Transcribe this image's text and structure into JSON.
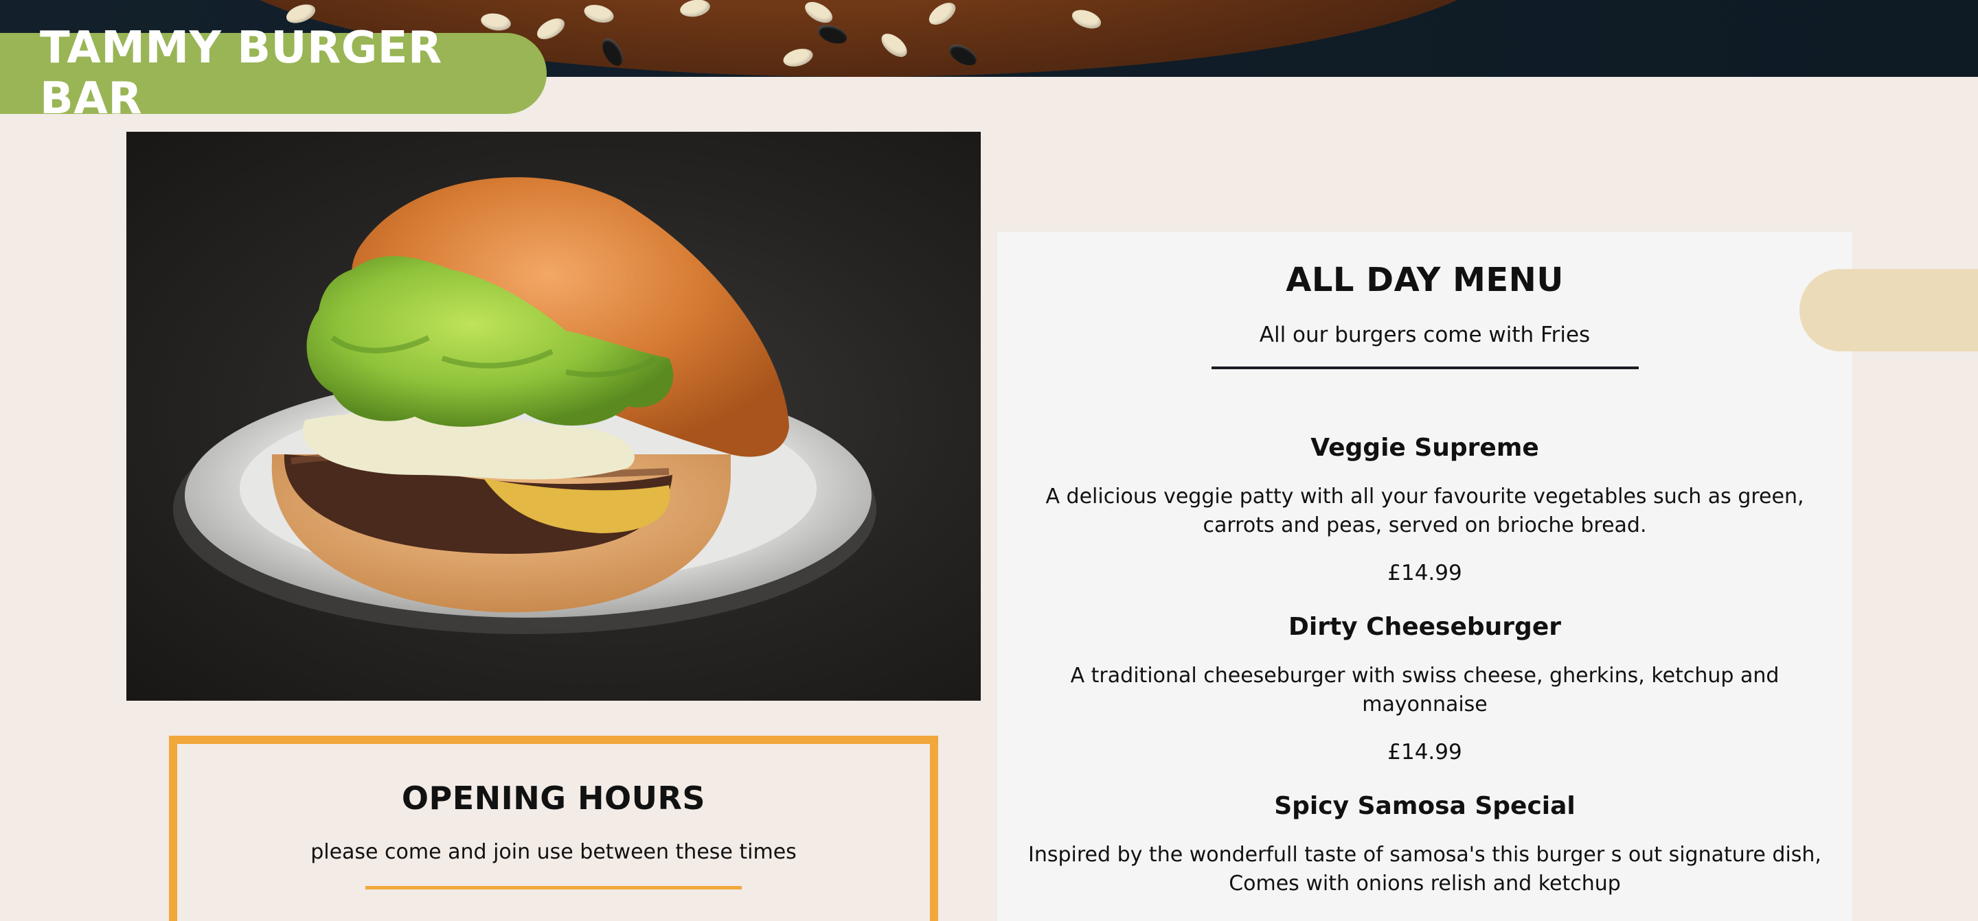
{
  "header": {
    "brand": "TAMMY BURGER BAR"
  },
  "hero_image": {
    "subject": "burger-photo"
  },
  "opening_hours": {
    "title": "OPENING HOURS",
    "subtitle": "please come and join use between these times"
  },
  "menu": {
    "title": "ALL DAY MENU",
    "subtitle": "All our burgers come with Fries",
    "items": [
      {
        "name": "Veggie Supreme",
        "description": "A delicious veggie patty with all your favourite vegetables such as green, carrots and peas, served on brioche bread.",
        "price": "£14.99"
      },
      {
        "name": "Dirty Cheeseburger",
        "description": "A traditional cheeseburger with swiss cheese, gherkins, ketchup and mayonnaise",
        "price": "£14.99"
      },
      {
        "name": "Spicy Samosa Special",
        "description": "Inspired by the wonderfull taste of samosa's this burger s out signature dish, Comes with onions relish and ketchup"
      }
    ]
  },
  "colors": {
    "brand_green": "#99b555",
    "hours_orange": "#f1a73a",
    "accent_beige": "#ecdbb8",
    "page_bg": "#f2ebe6"
  }
}
